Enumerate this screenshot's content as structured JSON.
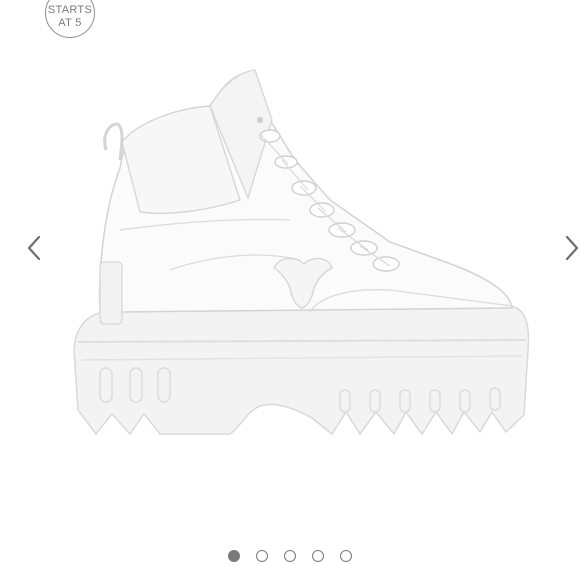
{
  "badge": {
    "line1": "STARTS",
    "line2": "AT 5"
  },
  "carousel": {
    "prev_icon": "chevron-left-icon",
    "next_icon": "chevron-right-icon",
    "slide_count": 5,
    "active_index": 0
  },
  "colors": {
    "control": "#7a7a7a",
    "background": "#ffffff"
  }
}
